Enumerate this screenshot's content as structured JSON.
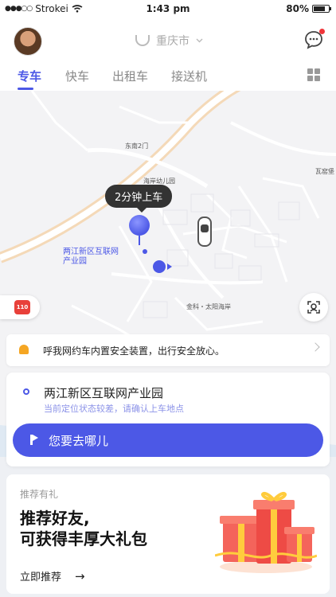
{
  "status_bar": {
    "carrier": "Strokei",
    "time": "1:43 pm",
    "battery": "80%"
  },
  "header": {
    "city": "重庆市",
    "city_chevron_icon": "chevron-down",
    "chat_icon": "chat-bubble-icon"
  },
  "tabs": [
    {
      "label": "专车",
      "active": true
    },
    {
      "label": "快车",
      "active": false
    },
    {
      "label": "出租车",
      "active": false
    },
    {
      "label": "接送机",
      "active": false
    }
  ],
  "map": {
    "labels": {
      "east_gate": "东南2门",
      "kindergarten": "海岸幼儿园",
      "park": "两江新区互联网\n产业园",
      "residential": "金科・太阳海岸",
      "edge_label": "瓦窑堡"
    },
    "pickup_bubble": "2分钟上车",
    "sos_label": "110"
  },
  "notice": {
    "text": "呼我网约车内置安全装置，出行安全放心。"
  },
  "order": {
    "pickup": "两江新区互联网产业园",
    "pickup_hint": "当前定位状态较差，请确认上车地点",
    "destination_placeholder": "您要去哪儿"
  },
  "promo": {
    "tag": "推荐有礼",
    "title_line1": "推荐好友,",
    "title_line2": "可获得丰厚大礼包",
    "link": "立即推荐"
  },
  "colors": {
    "accent": "#4c58e6",
    "alert": "#e8403a"
  }
}
